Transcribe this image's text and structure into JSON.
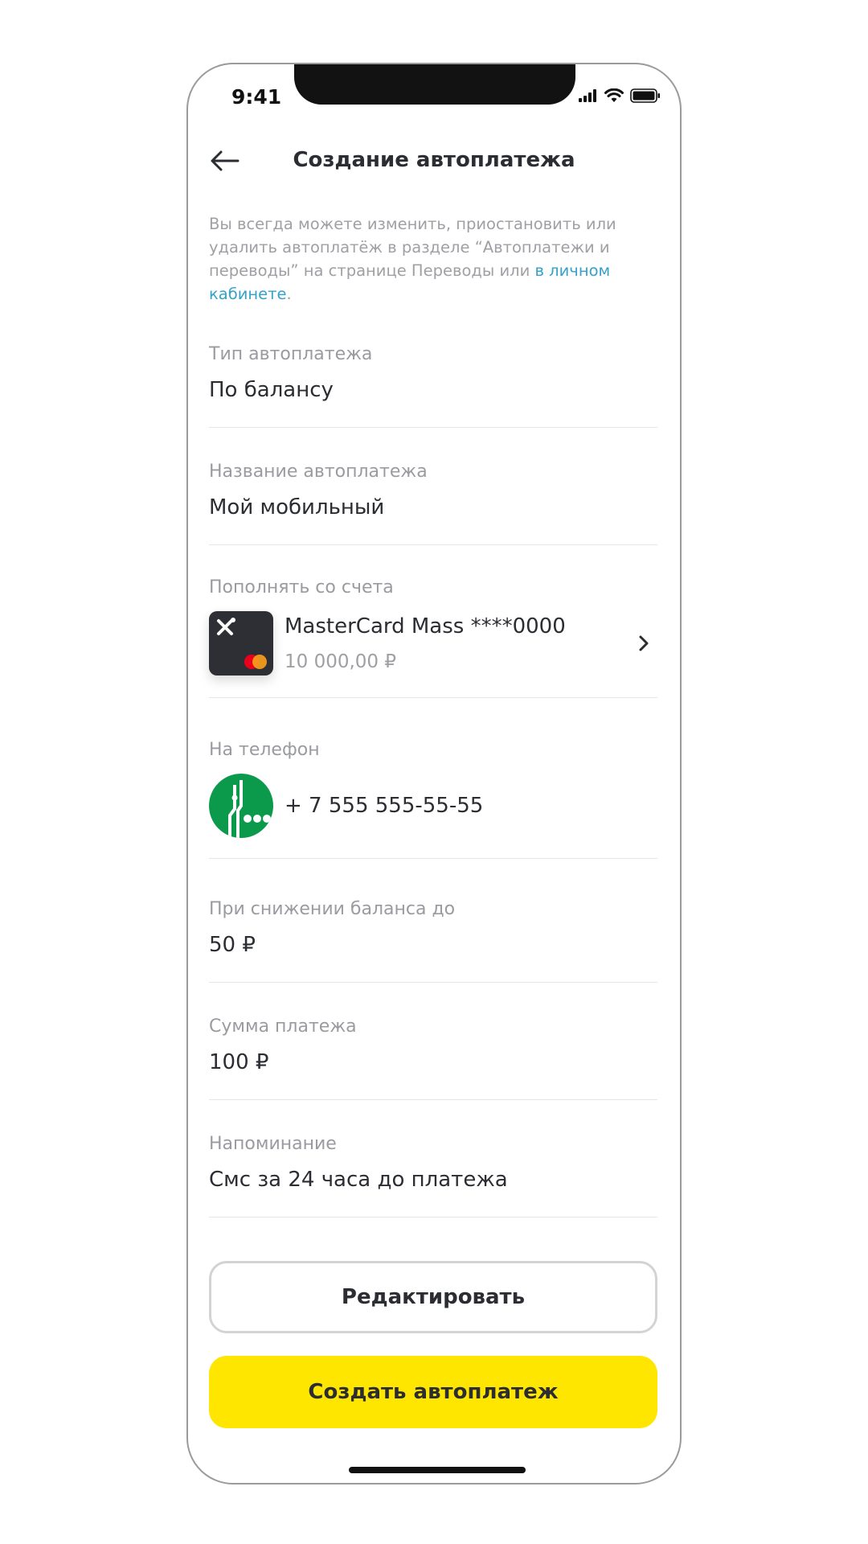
{
  "status_bar": {
    "time": "9:41"
  },
  "header": {
    "title": "Создание автоплатежа",
    "back_icon": "arrow-left-icon"
  },
  "info": {
    "text": "Вы всегда можете изменить, приостановить или удалить автоплатёж в разделе “Автоплатежи и переводы” на странице Переводы или ",
    "link": "в личном кабинете",
    "end": "."
  },
  "fields": {
    "type": {
      "label": "Тип автоплатежа",
      "value": "По балансу"
    },
    "name": {
      "label": "Название автоплатежа",
      "value": "Мой мобильный"
    },
    "source": {
      "label": "Пополнять со счета",
      "card_name": "MasterCard Mass ****0000",
      "balance": "10 000,00 ₽"
    },
    "phone": {
      "label": "На телефон",
      "number": "+ 7 555 555-55-55"
    },
    "threshold": {
      "label": "При снижении баланса до",
      "value": "50 ₽"
    },
    "amount": {
      "label": "Сумма платежа",
      "value": "100 ₽"
    },
    "reminder": {
      "label": "Напоминание",
      "value": "Смс за 24 часа до платежа"
    }
  },
  "buttons": {
    "edit": "Редактировать",
    "create": "Создать автоплатеж"
  },
  "colors": {
    "accent_yellow": "#fee600",
    "link_blue": "#34a2c9",
    "operator_green": "#0b9a4c",
    "mastercard_red": "#eb001b",
    "mastercard_orange": "#f79e1b"
  }
}
